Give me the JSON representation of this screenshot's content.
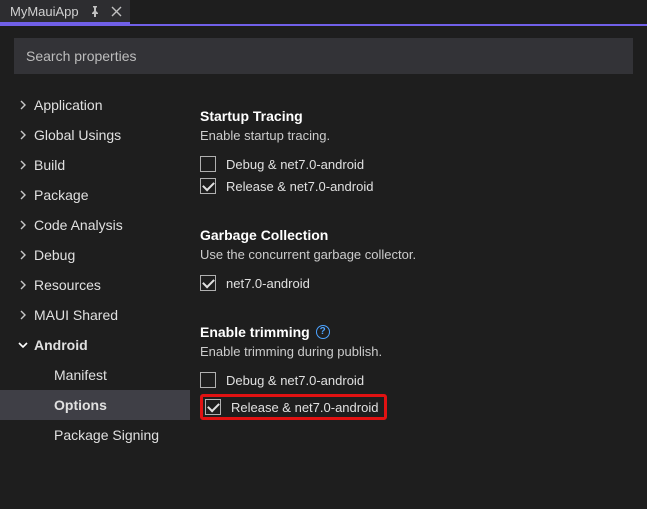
{
  "tab": {
    "title": "MyMauiApp"
  },
  "search": {
    "placeholder": "Search properties"
  },
  "sidebar": {
    "items": [
      {
        "label": "Application",
        "expanded": false
      },
      {
        "label": "Global Usings",
        "expanded": false
      },
      {
        "label": "Build",
        "expanded": false
      },
      {
        "label": "Package",
        "expanded": false
      },
      {
        "label": "Code Analysis",
        "expanded": false
      },
      {
        "label": "Debug",
        "expanded": false
      },
      {
        "label": "Resources",
        "expanded": false
      },
      {
        "label": "MAUI Shared",
        "expanded": false
      },
      {
        "label": "Android",
        "expanded": true
      }
    ],
    "android_children": [
      {
        "label": "Manifest",
        "selected": false
      },
      {
        "label": "Options",
        "selected": true
      },
      {
        "label": "Package Signing",
        "selected": false
      }
    ]
  },
  "sections": {
    "startup": {
      "title": "Startup Tracing",
      "desc": "Enable startup tracing.",
      "options": [
        {
          "label": "Debug & net7.0-android",
          "checked": false
        },
        {
          "label": "Release & net7.0-android",
          "checked": true
        }
      ]
    },
    "gc": {
      "title": "Garbage Collection",
      "desc": "Use the concurrent garbage collector.",
      "options": [
        {
          "label": "net7.0-android",
          "checked": true
        }
      ]
    },
    "trimming": {
      "title": "Enable trimming",
      "desc": "Enable trimming during publish.",
      "options": [
        {
          "label": "Debug & net7.0-android",
          "checked": false
        },
        {
          "label": "Release & net7.0-android",
          "checked": true,
          "highlighted": true
        }
      ]
    }
  }
}
